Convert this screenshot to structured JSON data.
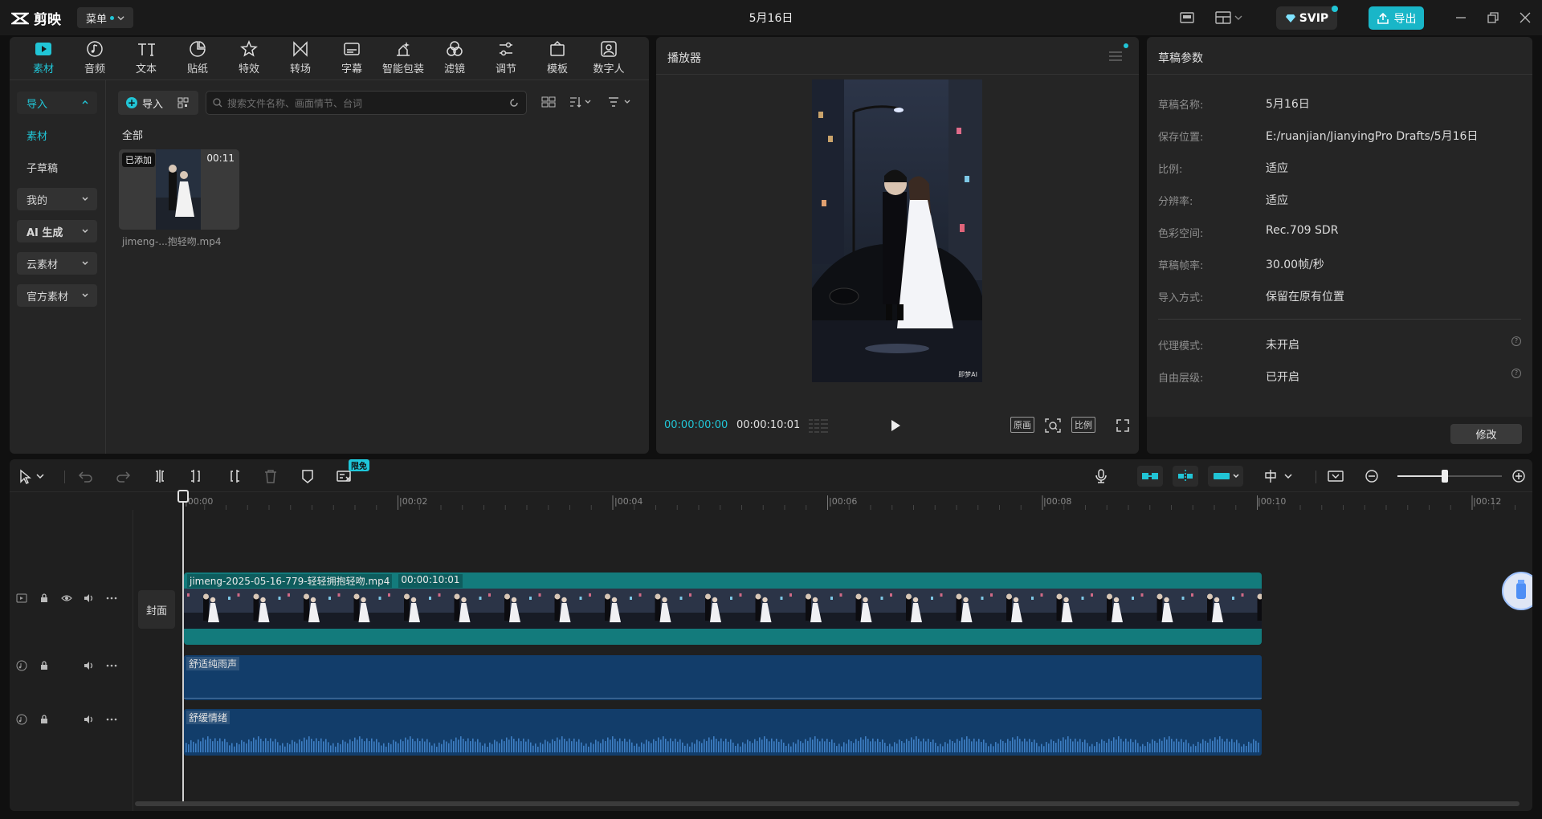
{
  "app": {
    "name": "剪映",
    "menu": "菜单",
    "project_title": "5月16日",
    "svip": "SVIP",
    "export": "导出"
  },
  "tools": [
    {
      "label": "素材",
      "icon": "media-icon",
      "active": true
    },
    {
      "label": "音频",
      "icon": "audio-icon"
    },
    {
      "label": "文本",
      "icon": "text-icon"
    },
    {
      "label": "贴纸",
      "icon": "sticker-icon"
    },
    {
      "label": "特效",
      "icon": "effects-icon"
    },
    {
      "label": "转场",
      "icon": "transition-icon"
    },
    {
      "label": "字幕",
      "icon": "subtitle-icon"
    },
    {
      "label": "智能包装",
      "icon": "smart-package-icon"
    },
    {
      "label": "滤镜",
      "icon": "filter-icon"
    },
    {
      "label": "调节",
      "icon": "adjust-icon"
    },
    {
      "label": "模板",
      "icon": "template-icon"
    },
    {
      "label": "数字人",
      "icon": "digital-human-icon"
    }
  ],
  "nav": {
    "import": "导入",
    "material": "素材",
    "subdraft": "子草稿",
    "mine": "我的",
    "ai": "AI 生成",
    "cloud": "云素材",
    "official": "官方素材"
  },
  "media": {
    "import_button": "导入",
    "search_placeholder": "搜索文件名称、画面情节、台词",
    "filter_all": "全部",
    "item": {
      "tag": "已添加",
      "duration": "00:11",
      "name": "jimeng-...抱轻吻.mp4"
    }
  },
  "player": {
    "title": "播放器",
    "current_time": "00:00:00:00",
    "total_time": "00:00:10:01",
    "original_btn": "原画",
    "ratio_btn": "比例",
    "watermark": "即梦AI"
  },
  "draft": {
    "title": "草稿参数",
    "rows": [
      {
        "k": "草稿名称:",
        "v": "5月16日"
      },
      {
        "k": "保存位置:",
        "v": "E:/ruanjian/JianyingPro Drafts/5月16日"
      },
      {
        "k": "比例:",
        "v": "适应"
      },
      {
        "k": "分辨率:",
        "v": "适应"
      },
      {
        "k": "色彩空间:",
        "v": "Rec.709 SDR"
      },
      {
        "k": "草稿帧率:",
        "v": "30.00帧/秒"
      },
      {
        "k": "导入方式:",
        "v": "保留在原有位置"
      }
    ],
    "rows2": [
      {
        "k": "代理模式:",
        "v": "未开启"
      },
      {
        "k": "自由层级:",
        "v": "已开启"
      }
    ],
    "modify": "修改"
  },
  "timeline": {
    "free_badge": "限免",
    "ruler": [
      "|00:00",
      "|00:02",
      "|00:04",
      "|00:06",
      "|00:08",
      "|00:10",
      "|00:12"
    ],
    "cover": "封面",
    "video_clip": {
      "name": "jimeng-2025-05-16-779-轻轻拥抱轻吻.mp4",
      "duration": "00:00:10:01"
    },
    "audio1": "舒适纯雨声",
    "audio2": "舒缓情绪",
    "zoom_level": 0.45
  },
  "colors": {
    "accent": "#21c5d6",
    "video_clip": "#137b7c",
    "audio_clip": "#123d6a"
  }
}
